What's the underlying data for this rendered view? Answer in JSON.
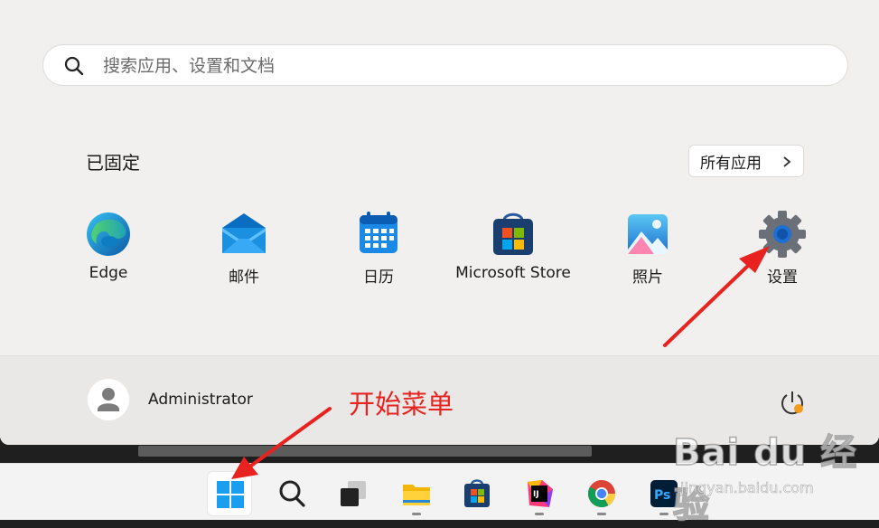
{
  "search": {
    "placeholder": "搜索应用、设置和文档",
    "icon": "search-icon"
  },
  "pinned": {
    "title": "已固定",
    "all_apps_label": "所有应用",
    "apps": [
      {
        "label": "Edge",
        "icon": "edge-icon"
      },
      {
        "label": "邮件",
        "icon": "mail-icon"
      },
      {
        "label": "日历",
        "icon": "calendar-icon"
      },
      {
        "label": "Microsoft Store",
        "icon": "store-icon"
      },
      {
        "label": "照片",
        "icon": "photos-icon"
      },
      {
        "label": "设置",
        "icon": "settings-icon"
      }
    ]
  },
  "footer": {
    "user_name": "Administrator",
    "icon": "power-icon"
  },
  "annotation": {
    "text": "开始菜单",
    "color": "#e8231f"
  },
  "taskbar": {
    "items": [
      {
        "name": "start",
        "icon": "windows-logo-icon"
      },
      {
        "name": "search",
        "icon": "search-icon"
      },
      {
        "name": "task-view",
        "icon": "task-view-icon"
      },
      {
        "name": "file-explorer",
        "icon": "folder-icon"
      },
      {
        "name": "store",
        "icon": "store-icon"
      },
      {
        "name": "jetbrains",
        "icon": "jetbrains-icon"
      },
      {
        "name": "chrome",
        "icon": "chrome-icon"
      },
      {
        "name": "photoshop",
        "icon": "photoshop-icon"
      }
    ]
  },
  "watermark": {
    "logo": "Bai du 经验",
    "url": "jingyan.baidu.com"
  },
  "colors": {
    "accent": "#0067c0",
    "arrow": "#e8231f",
    "menu_bg": "#f1f0ef"
  }
}
